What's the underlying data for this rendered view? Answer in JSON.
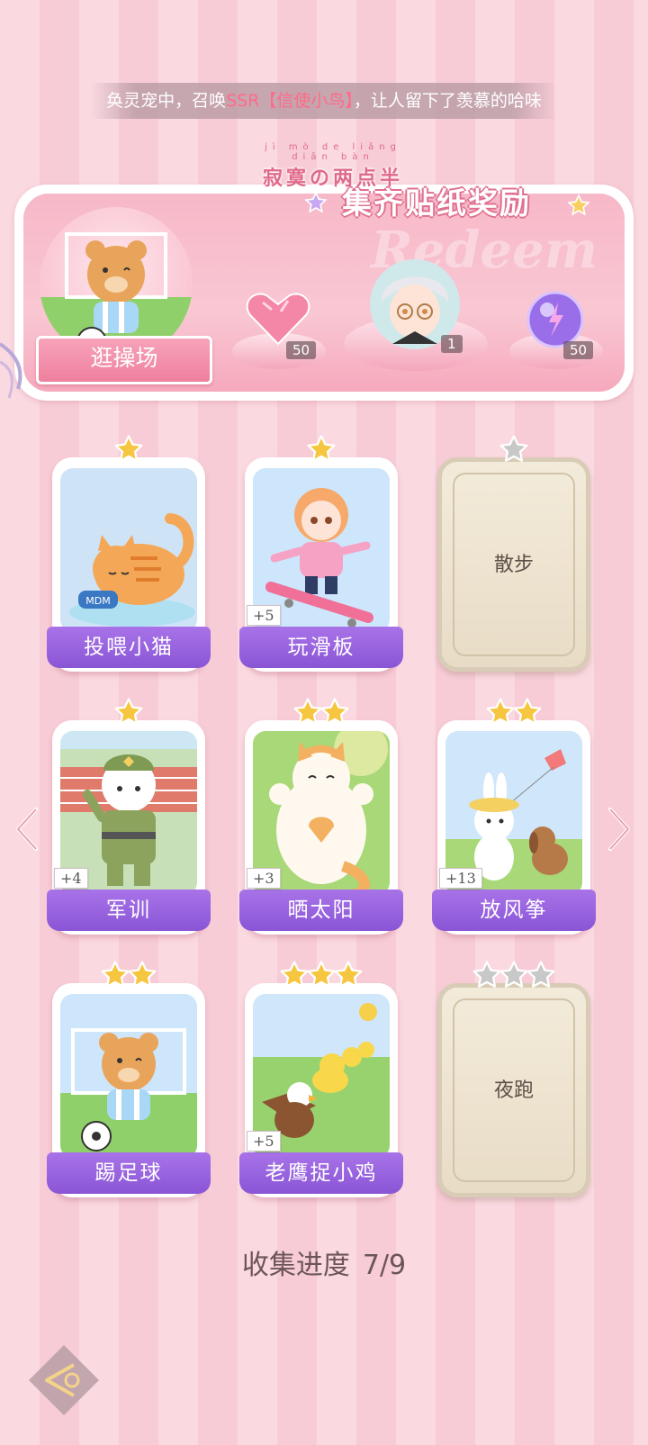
{
  "ticker": {
    "prefix": "奂灵宠中，召唤",
    "highlight": "SSR【信使小鸟】",
    "suffix": "，让人留下了羡慕的哈味"
  },
  "banner": {
    "brand_ruby": "jì mò de liǎng diǎn bàn",
    "brand_name": "寂寞の两点半",
    "title": "集齐贴纸奖励",
    "watermark": "Redeem",
    "go_button": "逛操场",
    "rewards": [
      {
        "icon": "pink-heart-gem-icon",
        "count": "50"
      },
      {
        "icon": "silver-hair-character-avatar",
        "count": "1"
      },
      {
        "icon": "purple-energy-orb-icon",
        "count": "50"
      }
    ]
  },
  "stickers": [
    {
      "name": "投喂小猫",
      "stars": 1,
      "collected": true,
      "bonus": "",
      "art": "orange-cat-eating-icon"
    },
    {
      "name": "玩滑板",
      "stars": 1,
      "collected": true,
      "bonus": "+5",
      "art": "girl-skateboard-icon"
    },
    {
      "name": "散步",
      "stars": 1,
      "collected": false,
      "bonus": "",
      "art": "locked-card"
    },
    {
      "name": "军训",
      "stars": 1,
      "collected": true,
      "bonus": "+4",
      "art": "cat-soldier-icon"
    },
    {
      "name": "晒太阳",
      "stars": 2,
      "collected": true,
      "bonus": "+3",
      "art": "cat-sunbathing-icon"
    },
    {
      "name": "放风筝",
      "stars": 2,
      "collected": true,
      "bonus": "+13",
      "art": "bunny-kite-icon"
    },
    {
      "name": "踢足球",
      "stars": 2,
      "collected": true,
      "bonus": "",
      "art": "bear-soccer-icon"
    },
    {
      "name": "老鹰捉小鸡",
      "stars": 3,
      "collected": true,
      "bonus": "+5",
      "art": "eagle-chicks-icon"
    },
    {
      "name": "夜跑",
      "stars": 3,
      "collected": false,
      "bonus": "",
      "art": "locked-card"
    }
  ],
  "progress": {
    "label": "收集进度",
    "value": "7/9",
    "collected": 7,
    "total": 9
  },
  "colors": {
    "accent_purple": "#9a63df",
    "pink": "#f7a3ba",
    "star_gold": "#f7c640",
    "star_grey": "#c8c8c8"
  }
}
